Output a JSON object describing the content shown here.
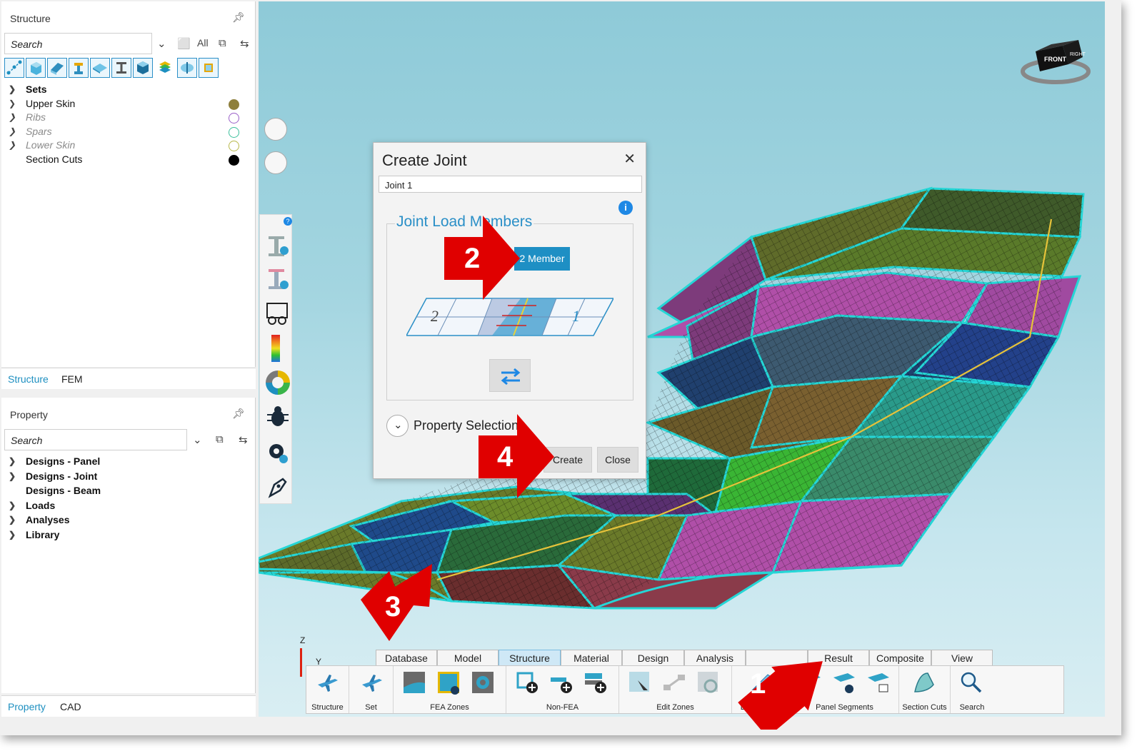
{
  "structure_panel": {
    "title": "Structure",
    "search_placeholder": "Search",
    "filter_all": "All",
    "tree": [
      {
        "label": "Sets",
        "bold": true
      },
      {
        "label": "Upper Skin",
        "color": "#8e7f3c",
        "filled": true
      },
      {
        "label": "Ribs",
        "dim": true,
        "color": "#9a60c8"
      },
      {
        "label": "Spars",
        "dim": true,
        "color": "#3bbf9c"
      },
      {
        "label": "Lower Skin",
        "dim": true,
        "color": "#b8b84a"
      },
      {
        "label": "Section Cuts",
        "color": "#000000",
        "filled": true
      }
    ],
    "tabs": [
      "Structure",
      "FEM"
    ]
  },
  "property_panel": {
    "title": "Property",
    "search_placeholder": "Search",
    "tree": [
      "Designs - Panel",
      "Designs - Joint",
      "Designs - Beam",
      "Loads",
      "Analyses",
      "Library"
    ],
    "tabs": [
      "Property",
      "CAD"
    ]
  },
  "dialog": {
    "title": "Create Joint",
    "name_value": "Joint 1",
    "group_title": "Joint Load Members",
    "member_button": "2 Member",
    "expander_label": "Property Selection",
    "create_button": "Create",
    "close_button": "Close",
    "info_icon": "i"
  },
  "viewcube": {
    "front": "FRONT",
    "right": "RIGHT"
  },
  "axes": {
    "z": "Z",
    "y": "Y"
  },
  "ribbon": {
    "tabs": [
      "Database",
      "Model",
      "Structure",
      "Material",
      "Design",
      "Analysis",
      "",
      "Result",
      "Composite",
      "View"
    ],
    "active_tab": "Structure",
    "groups": [
      "Structure",
      "Set",
      "FEA Zones",
      "Non-FEA",
      "Edit Zones",
      "Edge Joints",
      "Panel Segments",
      "Section Cuts",
      "Search"
    ]
  },
  "annotations": [
    "1",
    "2",
    "3",
    "4"
  ],
  "colors": {
    "accent": "#1e8fc4",
    "annotation": "#e00000",
    "mesh_edge": "#1fd3d3"
  }
}
